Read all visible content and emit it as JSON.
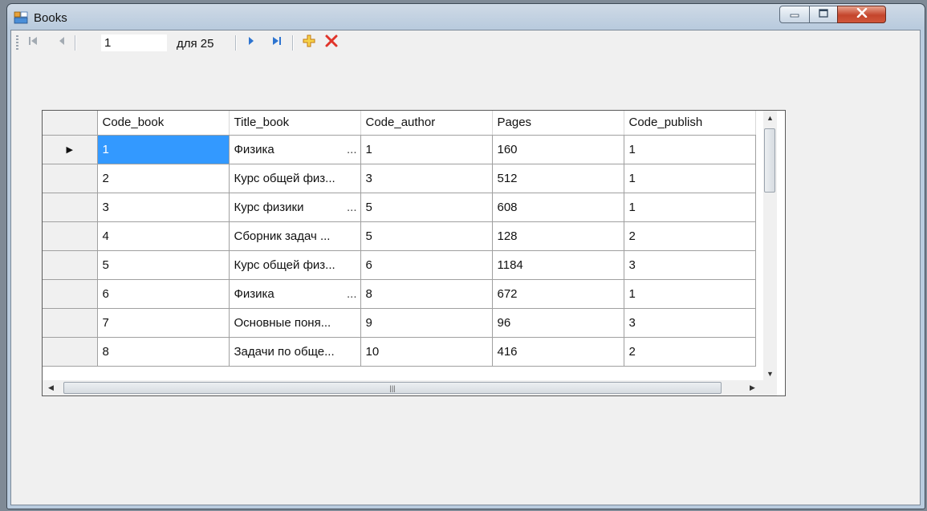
{
  "window": {
    "title": "Books",
    "accent_close": "#c4452c"
  },
  "navigator": {
    "position_value": "1",
    "count_label": "для 25"
  },
  "grid": {
    "columns": [
      "Code_book",
      "Title_book",
      "Code_author",
      "Pages",
      "Code_publish"
    ],
    "rows": [
      {
        "code_book": "1",
        "title_book": "Физика",
        "title_truncated": true,
        "code_author": "1",
        "pages": "160",
        "code_publish": "1"
      },
      {
        "code_book": "2",
        "title_book": "Курс общей физ...",
        "title_truncated": false,
        "code_author": "3",
        "pages": "512",
        "code_publish": "1"
      },
      {
        "code_book": "3",
        "title_book": "Курс физики",
        "title_truncated": true,
        "code_author": "5",
        "pages": "608",
        "code_publish": "1"
      },
      {
        "code_book": "4",
        "title_book": "Сборник задач ...",
        "title_truncated": false,
        "code_author": "5",
        "pages": "128",
        "code_publish": "2"
      },
      {
        "code_book": "5",
        "title_book": "Курс общей физ...",
        "title_truncated": false,
        "code_author": "6",
        "pages": "1184",
        "code_publish": "3"
      },
      {
        "code_book": "6",
        "title_book": "Физика",
        "title_truncated": true,
        "code_author": "8",
        "pages": "672",
        "code_publish": "1"
      },
      {
        "code_book": "7",
        "title_book": "Основные поня...",
        "title_truncated": false,
        "code_author": "9",
        "pages": "96",
        "code_publish": "3"
      },
      {
        "code_book": "8",
        "title_book": "Задачи по обще...",
        "title_truncated": false,
        "code_author": "10",
        "pages": "416",
        "code_publish": "2"
      }
    ],
    "current_row_marker": "▶",
    "selection_color": "#3399ff"
  }
}
